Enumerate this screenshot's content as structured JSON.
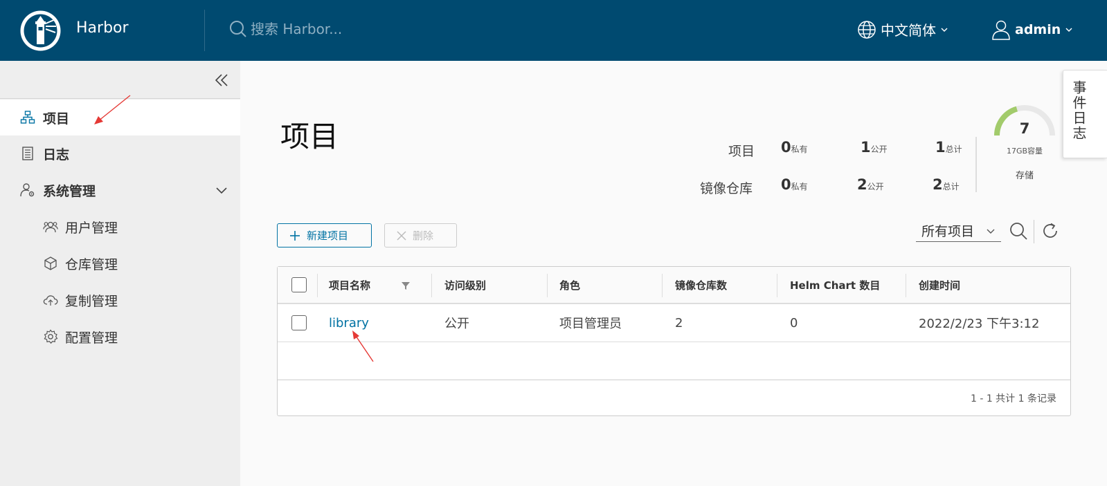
{
  "header": {
    "brand": "Harbor",
    "search_placeholder": "搜索 Harbor...",
    "language": "中文简体",
    "user": "admin"
  },
  "sidebar": {
    "items": [
      {
        "label": "项目",
        "icon": "projects-icon",
        "active": true
      },
      {
        "label": "日志",
        "icon": "logs-icon"
      },
      {
        "label": "系统管理",
        "icon": "admin-icon"
      }
    ],
    "sub_items": [
      {
        "label": "用户管理",
        "icon": "users-icon"
      },
      {
        "label": "仓库管理",
        "icon": "registry-icon"
      },
      {
        "label": "复制管理",
        "icon": "replication-icon"
      },
      {
        "label": "配置管理",
        "icon": "config-icon"
      }
    ]
  },
  "main": {
    "title": "项目",
    "stats": {
      "rows": [
        {
          "label": "项目",
          "private": "0",
          "public": "1",
          "total": "1"
        },
        {
          "label": "镜像仓库",
          "private": "0",
          "public": "2",
          "total": "2"
        }
      ],
      "private_suffix": "私有",
      "public_suffix": "公开",
      "total_suffix": "总计"
    },
    "storage": {
      "value": "7",
      "capacity": "17GB容量",
      "label": "存储",
      "used_fraction": 0.41
    },
    "event_log": "事件日志",
    "buttons": {
      "new_project": "新建项目",
      "delete": "删除"
    },
    "filter": "所有项目",
    "table": {
      "columns": [
        "项目名称",
        "访问级别",
        "角色",
        "镜像仓库数",
        "Helm Chart 数目",
        "创建时间"
      ],
      "rows": [
        {
          "name": "library",
          "access": "公开",
          "role": "项目管理员",
          "repos": "2",
          "charts": "0",
          "created": "2022/2/23 下午3:12"
        }
      ],
      "footer": "1 - 1 共计 1 条记录"
    }
  },
  "colors": {
    "header_bg": "#004a70",
    "accent": "#0072a3",
    "gauge": "#a2cb6b",
    "annotation_arrow": "#e53935"
  }
}
